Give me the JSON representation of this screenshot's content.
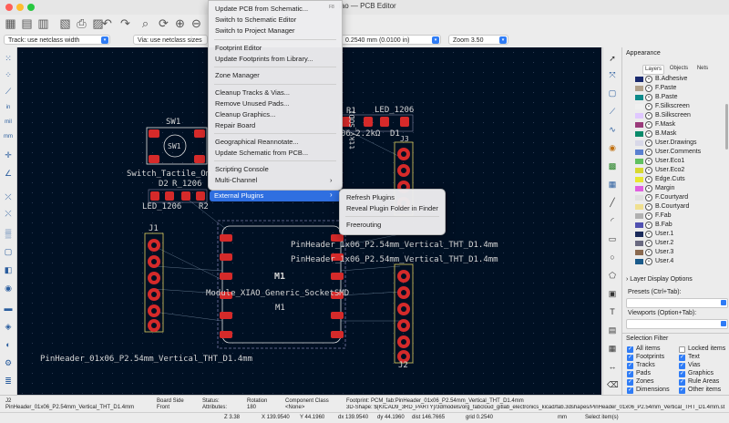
{
  "window": {
    "title": "iao — PCB Editor"
  },
  "colors": {
    "accent": "#2f7cf6",
    "canvas_bg": "#001023",
    "pad_red": "#d52a2a",
    "menu_highlight": "#2f6fe0"
  },
  "toolbar": {
    "icons": [
      "new-board-icon",
      "open-icon",
      "save-icon",
      "page-settings-icon",
      "print-icon",
      "plot-icon",
      "undo-icon",
      "redo-icon",
      "refresh-icon",
      "find-icon",
      "zoom-in-icon",
      "zoom-out-icon",
      "zoom-fit-icon"
    ]
  },
  "trackbar": {
    "track": "Track: use netclass width",
    "via": "Via: use netclass sizes",
    "grid": "0.2540 mm (0.0100 in)",
    "zoom": "Zoom 3.50"
  },
  "menu": {
    "items": [
      {
        "label": "Update PCB from Schematic...",
        "shortcut": "F8"
      },
      {
        "label": "Switch to Schematic Editor"
      },
      {
        "label": "Switch to Project Manager"
      },
      {
        "label": "Footprint Editor"
      },
      {
        "label": "Update Footprints from Library..."
      },
      {
        "label": "Zone Manager"
      },
      {
        "label": "Cleanup Tracks & Vias..."
      },
      {
        "label": "Remove Unused Pads..."
      },
      {
        "label": "Cleanup Graphics..."
      },
      {
        "label": "Repair Board"
      },
      {
        "label": "Geographical Reannotate..."
      },
      {
        "label": "Update Schematic from PCB..."
      },
      {
        "label": "Scripting Console"
      },
      {
        "label": "Multi-Channel"
      },
      {
        "label": "External Plugins"
      }
    ],
    "submenu": [
      "Refresh Plugins",
      "Reveal Plugin Folder in Finder",
      "Freerouting"
    ]
  },
  "pcb": {
    "labels": {
      "sw1": "SW1",
      "sw1_body": "SW1",
      "sw1_value": "Switch_Tactile_Om",
      "d2": "D2",
      "r2a": "R_1206",
      "led_a": "LED_1206",
      "r2b": "R2",
      "r1": "R1",
      "led_b": "LED_1206",
      "r1_value": "06 2.2kΩ",
      "d1": "D1",
      "schottky": "ttky_SOD1",
      "j1": "J1",
      "j2": "J2",
      "j3": "J3",
      "m1_top": "M1",
      "m1_bot": "M1",
      "module": "Module_XIAO_Generic_SocketSMD",
      "pinheader_a": "PinHeader_1x06_P2.54mm_Vertical_THT_D1.4mm",
      "pinheader_b": "PinHeader_1x06_P2.54mm_Vertical_THT_D1.4mm",
      "pinheader_c": "PinHeader_01x06_P2.54mm_Vertical_THT_D1.4mm",
      "r1_pad1": "R1",
      "d1_pad": "D1"
    }
  },
  "appearance": {
    "title": "Appearance",
    "tabs": [
      "Layers",
      "Objects",
      "Nets"
    ],
    "layers": [
      {
        "name": "B.Adhesive",
        "color": "#1a2a6e"
      },
      {
        "name": "F.Paste",
        "color": "#b0a08a"
      },
      {
        "name": "B.Paste",
        "color": "#0d8a8a"
      },
      {
        "name": "F.Silkscreen",
        "color": "#f0f0f0"
      },
      {
        "name": "B.Silkscreen",
        "color": "#e0c8ff"
      },
      {
        "name": "F.Mask",
        "color": "#9a3a7a"
      },
      {
        "name": "B.Mask",
        "color": "#0a8a6a"
      },
      {
        "name": "User.Drawings",
        "color": "#d8d8e8"
      },
      {
        "name": "User.Comments",
        "color": "#5a80d0"
      },
      {
        "name": "User.Eco1",
        "color": "#60c060"
      },
      {
        "name": "User.Eco2",
        "color": "#d8d830"
      },
      {
        "name": "Edge.Cuts",
        "color": "#e8e830"
      },
      {
        "name": "Margin",
        "color": "#e060e0"
      },
      {
        "name": "F.Courtyard",
        "color": "#e0e0e0"
      },
      {
        "name": "B.Courtyard",
        "color": "#f0e090"
      },
      {
        "name": "F.Fab",
        "color": "#b0b0b0"
      },
      {
        "name": "B.Fab",
        "color": "#5050b0"
      },
      {
        "name": "User.1",
        "color": "#1a2a5a"
      },
      {
        "name": "User.2",
        "color": "#6a6a80"
      },
      {
        "name": "User.3",
        "color": "#8a6a50"
      },
      {
        "name": "User.4",
        "color": "#1a5a8a"
      }
    ],
    "layer_display_options": "Layer Display Options",
    "presets_label": "Presets (Ctrl+Tab):",
    "viewports_label": "Viewports (Option+Tab):",
    "selection_filter": "Selection Filter",
    "filters_left": [
      {
        "label": "All items",
        "checked": true
      },
      {
        "label": "Footprints",
        "checked": true
      },
      {
        "label": "Tracks",
        "checked": true
      },
      {
        "label": "Pads",
        "checked": true
      },
      {
        "label": "Zones",
        "checked": true
      },
      {
        "label": "Dimensions",
        "checked": true
      }
    ],
    "filters_right": [
      {
        "label": "Locked items",
        "checked": false
      },
      {
        "label": "Text",
        "checked": true
      },
      {
        "label": "Vias",
        "checked": true
      },
      {
        "label": "Graphics",
        "checked": true
      },
      {
        "label": "Rule Areas",
        "checked": true
      },
      {
        "label": "Other items",
        "checked": true
      }
    ]
  },
  "status": {
    "ref": "J2",
    "value": "PinHeader_01x06_P2.54mm_Vertical_THT_D1.4mm",
    "side_label": "Board Side",
    "side_value": "Front",
    "status_label": "Status:",
    "attributes_label": "Attributes:",
    "rotation_label": "Rotation",
    "rotation_value": "180",
    "class_label": "Component Class",
    "class_value": "<None>",
    "footprint": "Footprint: PCM_fab:PinHeader_01x06_P2.54mm_Vertical_THT_D1.4mm",
    "shape": "3D-Shape: ${KICAD9_3RD_PARTY}/3dmodels/org_fabcloud_gitlab_electronics_kicad/fab.3dshapes/PinHeader_01x06_P2.54mm_Vertical_THT_D1.4mm.st",
    "z": "Z 3.38",
    "x": "X 139.9540",
    "y": "Y 44.1960",
    "dx": "dx 139.9540",
    "dy": "dy 44.1960",
    "dist": "dist 146.7665",
    "grid": "grid 0.2540",
    "units": "mm",
    "mode": "Select item(s)"
  }
}
